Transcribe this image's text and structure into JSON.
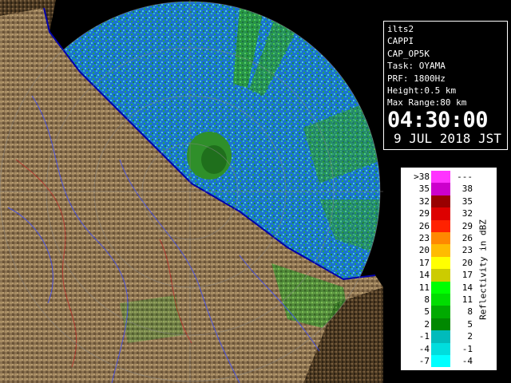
{
  "info": {
    "lines": [
      "ilts2",
      "CAPPI",
      "CAP_OP5K",
      "Task: OYAMA",
      "PRF: 1800Hz",
      "Height:0.5 km",
      "Max Range:80 km"
    ],
    "time": "04:30:00",
    "date": "9 JUL 2018 JST"
  },
  "legend": {
    "title": "Reflectivity in dBZ",
    "rows": [
      {
        "low": ">38",
        "high": "---",
        "color": "#ff33ff"
      },
      {
        "low": "35",
        "high": "38",
        "color": "#cc00cc"
      },
      {
        "low": "32",
        "high": "35",
        "color": "#990000"
      },
      {
        "low": "29",
        "high": "32",
        "color": "#dd0000"
      },
      {
        "low": "26",
        "high": "29",
        "color": "#ff2200"
      },
      {
        "low": "23",
        "high": "26",
        "color": "#ff8800"
      },
      {
        "low": "20",
        "high": "23",
        "color": "#ffbb00"
      },
      {
        "low": "17",
        "high": "20",
        "color": "#ffff00"
      },
      {
        "low": "14",
        "high": "17",
        "color": "#cccc00"
      },
      {
        "low": "11",
        "high": "14",
        "color": "#00ff00"
      },
      {
        "low": "8",
        "high": "11",
        "color": "#00dd00"
      },
      {
        "low": "5",
        "high": "8",
        "color": "#00aa00"
      },
      {
        "low": "2",
        "high": "5",
        "color": "#008800"
      },
      {
        "low": "-1",
        "high": "2",
        "color": "#00bbbb"
      },
      {
        "low": "-4",
        "high": "-1",
        "color": "#00dddd"
      },
      {
        "low": "-7",
        "high": "-4",
        "color": "#00ffff"
      }
    ]
  }
}
